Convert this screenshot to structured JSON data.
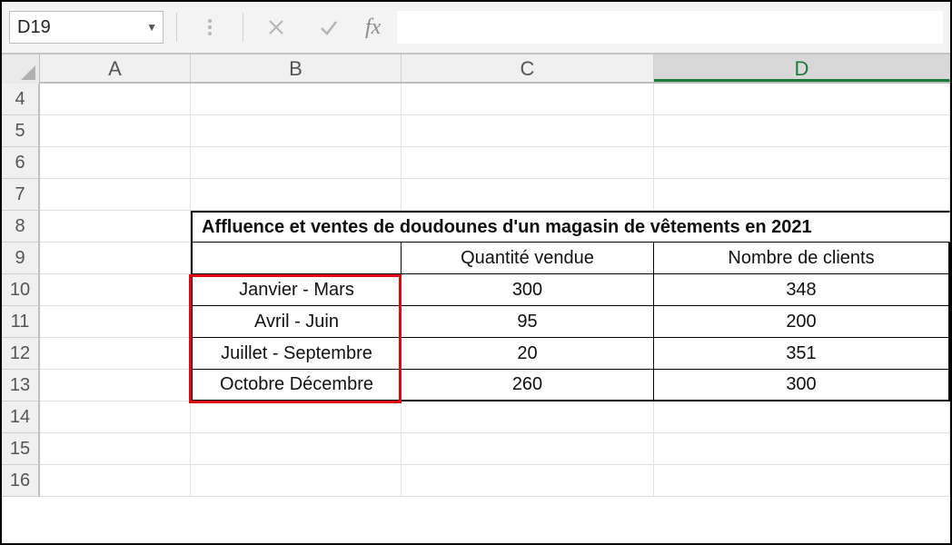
{
  "formula_bar": {
    "name_box": "D19",
    "formula_value": "",
    "fx_label": "fx"
  },
  "columns": [
    "A",
    "B",
    "C",
    "D"
  ],
  "row_headers": [
    "4",
    "5",
    "6",
    "7",
    "8",
    "9",
    "10",
    "11",
    "12",
    "13",
    "14",
    "15",
    "16"
  ],
  "selected_column": "D",
  "table": {
    "title": "Affluence et ventes de doudounes d'un magasin de vêtements en 2021",
    "headers": {
      "period": "",
      "qty": "Quantité vendue",
      "clients": "Nombre de clients"
    },
    "rows": [
      {
        "period": "Janvier - Mars",
        "qty": "300",
        "clients": "348"
      },
      {
        "period": "Avril - Juin",
        "qty": "95",
        "clients": "200"
      },
      {
        "period": "Juillet - Septembre",
        "qty": "20",
        "clients": "351"
      },
      {
        "period": "Octobre Décembre",
        "qty": "260",
        "clients": "300"
      }
    ]
  }
}
